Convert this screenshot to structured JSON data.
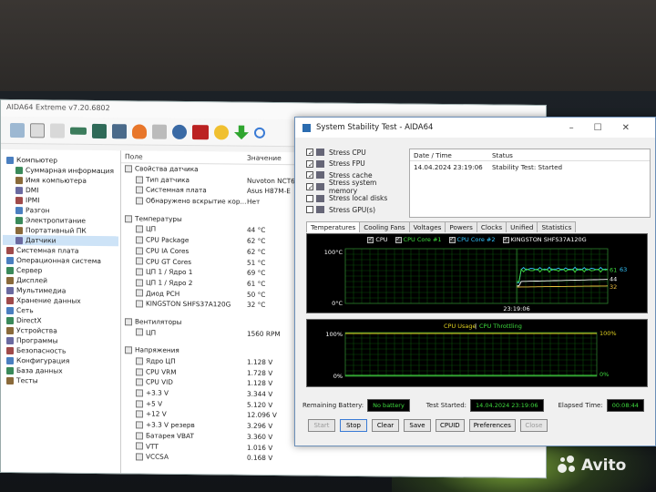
{
  "main_window": {
    "title": "AIDA64 Extreme v7.20.6802",
    "columns": {
      "field": "Поле",
      "value": "Значение"
    },
    "tree": [
      {
        "label": "Компьютер",
        "level": 0
      },
      {
        "label": "Суммарная информация",
        "level": 1
      },
      {
        "label": "Имя компьютера",
        "level": 1
      },
      {
        "label": "DMI",
        "level": 1
      },
      {
        "label": "IPMI",
        "level": 1
      },
      {
        "label": "Разгон",
        "level": 1
      },
      {
        "label": "Электропитание",
        "level": 1
      },
      {
        "label": "Портативный ПК",
        "level": 1
      },
      {
        "label": "Датчики",
        "level": 1,
        "selected": true
      },
      {
        "label": "Системная плата",
        "level": 0
      },
      {
        "label": "Операционная система",
        "level": 0
      },
      {
        "label": "Сервер",
        "level": 0
      },
      {
        "label": "Дисплей",
        "level": 0
      },
      {
        "label": "Мультимедиа",
        "level": 0
      },
      {
        "label": "Хранение данных",
        "level": 0
      },
      {
        "label": "Сеть",
        "level": 0
      },
      {
        "label": "DirectX",
        "level": 0
      },
      {
        "label": "Устройства",
        "level": 0
      },
      {
        "label": "Программы",
        "level": 0
      },
      {
        "label": "Безопасность",
        "level": 0
      },
      {
        "label": "Конфигурация",
        "level": 0
      },
      {
        "label": "База данных",
        "level": 0
      },
      {
        "label": "Тесты",
        "level": 0
      }
    ],
    "sections": [
      {
        "group": "Свойства датчика",
        "rows": [
          {
            "field": "Тип датчика",
            "value": "Nuvoton NCT6"
          },
          {
            "field": "Системная плата",
            "value": "Asus H87M-E"
          },
          {
            "field": "Обнаружено вскрытие кор...",
            "value": "Нет"
          }
        ]
      },
      {
        "group": "Температуры",
        "rows": [
          {
            "field": "ЦП",
            "value": "44 °C"
          },
          {
            "field": "CPU Package",
            "value": "62 °C"
          },
          {
            "field": "CPU IA Cores",
            "value": "62 °C"
          },
          {
            "field": "CPU GT Cores",
            "value": "51 °C"
          },
          {
            "field": "ЦП 1 / Ядро 1",
            "value": "69 °C"
          },
          {
            "field": "ЦП 1 / Ядро 2",
            "value": "61 °C"
          },
          {
            "field": "Диод PCH",
            "value": "50 °C"
          },
          {
            "field": "KINGSTON SHFS37A120G",
            "value": "32 °C"
          }
        ]
      },
      {
        "group": "Вентиляторы",
        "rows": [
          {
            "field": "ЦП",
            "value": "1560 RPM"
          }
        ]
      },
      {
        "group": "Напряжения",
        "rows": [
          {
            "field": "Ядро ЦП",
            "value": "1.128 V"
          },
          {
            "field": "CPU VRM",
            "value": "1.728 V"
          },
          {
            "field": "CPU VID",
            "value": "1.128 V"
          },
          {
            "field": "+3.3 V",
            "value": "3.344 V"
          },
          {
            "field": "+5 V",
            "value": "5.120 V"
          },
          {
            "field": "+12 V",
            "value": "12.096 V"
          },
          {
            "field": "+3.3 V резерв",
            "value": "3.296 V"
          },
          {
            "field": "Батарея VBAT",
            "value": "3.360 V"
          },
          {
            "field": "VTT",
            "value": "1.016 V"
          },
          {
            "field": "VCCSA",
            "value": "0.168 V"
          }
        ]
      }
    ]
  },
  "stability_window": {
    "title": "System Stability Test - AIDA64",
    "stress_options": [
      {
        "label": "Stress CPU",
        "checked": true
      },
      {
        "label": "Stress FPU",
        "checked": true
      },
      {
        "label": "Stress cache",
        "checked": true
      },
      {
        "label": "Stress system memory",
        "checked": true
      },
      {
        "label": "Stress local disks",
        "checked": false
      },
      {
        "label": "Stress GPU(s)",
        "checked": false
      }
    ],
    "status_header": {
      "date": "Date / Time",
      "status": "Status"
    },
    "status_row": {
      "date": "14.04.2024 23:19:06",
      "status": "Stability Test: Started"
    },
    "tabs": [
      "Temperatures",
      "Cooling Fans",
      "Voltages",
      "Powers",
      "Clocks",
      "Unified",
      "Statistics"
    ],
    "temp_legend": [
      {
        "label": "CPU",
        "color": "#ffffff"
      },
      {
        "label": "CPU Core #1",
        "color": "#3fdc3f"
      },
      {
        "label": "CPU Core #2",
        "color": "#33c6ff"
      },
      {
        "label": "KINGSTON SHFS37A120G",
        "color": "#ffffff"
      }
    ],
    "temp_axis": {
      "top": "100°C",
      "bottom": "0°C",
      "time": "23:19:06"
    },
    "temp_end_labels": [
      "61",
      "63",
      "44",
      "32"
    ],
    "usage_legend": {
      "a": "CPU Usage",
      "sep": "|",
      "b": "CPU Throttling"
    },
    "usage_axis": {
      "top_left": "100%",
      "bottom_left": "0%",
      "top_right": "100%",
      "bottom_right": "0%"
    },
    "remaining_battery_label": "Remaining Battery:",
    "remaining_battery_value": "No battery",
    "test_started_label": "Test Started:",
    "test_started_value": "14.04.2024 23:19:06",
    "elapsed_label": "Elapsed Time:",
    "elapsed_value": "00:08:44",
    "buttons": {
      "start": "Start",
      "stop": "Stop",
      "clear": "Clear",
      "save": "Save",
      "cpuid": "CPUID",
      "prefs": "Preferences",
      "close": "Close"
    },
    "colors": {
      "core1": "#3fdc3f",
      "core2": "#33c6ff",
      "cpu": "#ffffff",
      "disk": "#f0c040",
      "usage": "#e0d020"
    }
  },
  "watermark": {
    "text": "Avito"
  }
}
